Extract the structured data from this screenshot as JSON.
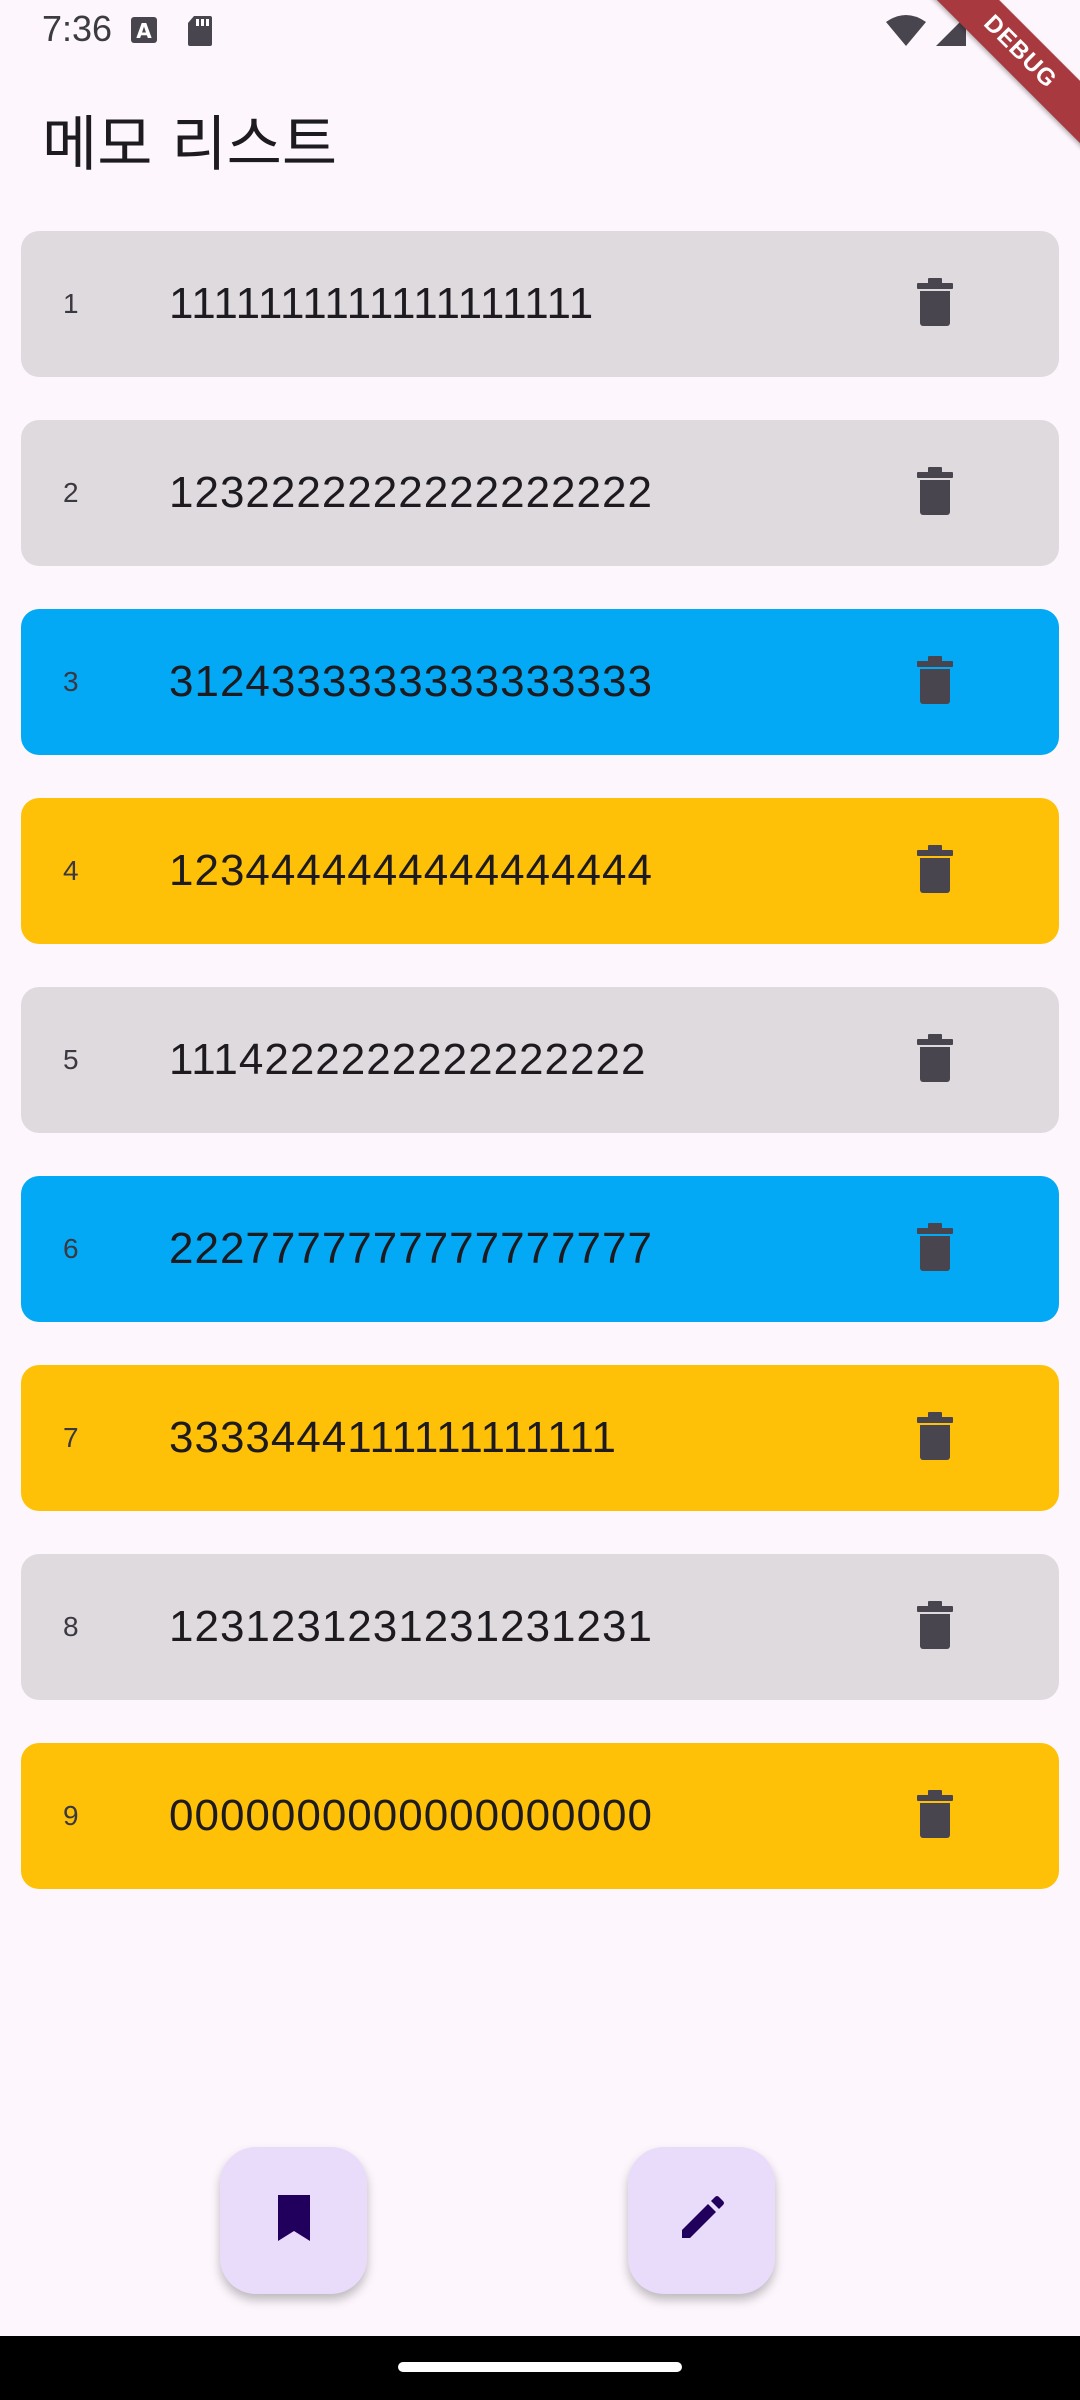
{
  "status_bar": {
    "time": "7:36",
    "debug_label": "DEBUG"
  },
  "app": {
    "title": "메모 리스트"
  },
  "colors": {
    "grey": "#dedade",
    "blue": "#03a9f4",
    "amber": "#ffc107",
    "icon": "#49454f",
    "fab_bg": "#e9dcfb",
    "fab_icon": "#21005d"
  },
  "memos": [
    {
      "index": "1",
      "text": "1111111111111111111",
      "color": "grey"
    },
    {
      "index": "2",
      "text": "1232222222222222222",
      "color": "grey"
    },
    {
      "index": "3",
      "text": "3124333333333333333",
      "color": "blue"
    },
    {
      "index": "4",
      "text": "1234444444444444444",
      "color": "amber"
    },
    {
      "index": "5",
      "text": "1114222222222222222",
      "color": "grey"
    },
    {
      "index": "6",
      "text": "2227777777777777777",
      "color": "blue"
    },
    {
      "index": "7",
      "text": "3333444111111111111",
      "color": "amber"
    },
    {
      "index": "8",
      "text": "1231231231231231231",
      "color": "grey"
    },
    {
      "index": "9",
      "text": "0000000000000000000",
      "color": "amber"
    }
  ],
  "fabs": [
    {
      "name": "bookmark-fab",
      "icon": "bookmark-icon"
    },
    {
      "name": "edit-fab",
      "icon": "pencil-icon"
    }
  ]
}
